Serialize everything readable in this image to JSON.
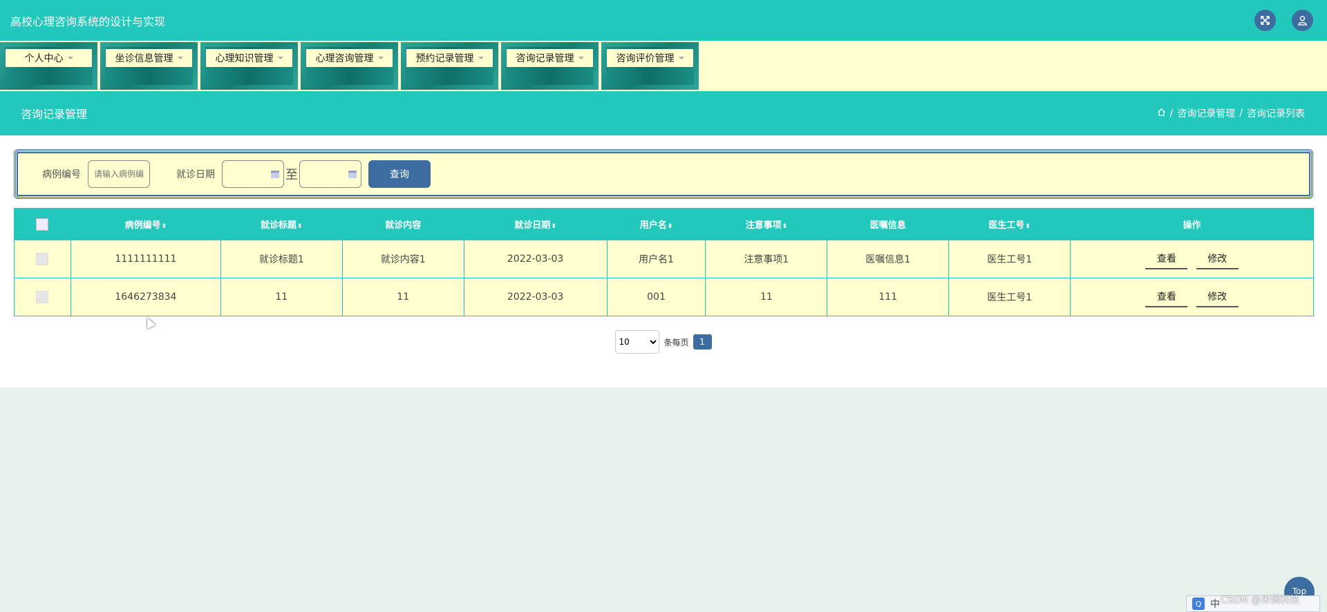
{
  "header": {
    "app_title": "高校心理咨询系统的设计与实现",
    "icons": [
      "fullscreen-icon",
      "user-icon"
    ]
  },
  "menu": {
    "items": [
      {
        "label": "个人中心"
      },
      {
        "label": "坐诊信息管理"
      },
      {
        "label": "心理知识管理"
      },
      {
        "label": "心理咨询管理"
      },
      {
        "label": "预约记录管理"
      },
      {
        "label": "咨询记录管理"
      },
      {
        "label": "咨询评价管理"
      }
    ]
  },
  "section": {
    "title": "咨询记录管理",
    "breadcrumb": [
      "咨询记录管理",
      "咨询记录列表"
    ]
  },
  "search": {
    "case_no_label": "病例编号",
    "case_no_placeholder": "请输入病例编号",
    "date_label": "就诊日期",
    "to_text": "至",
    "query_button": "查询"
  },
  "table": {
    "headers": [
      "病例编号",
      "就诊标题",
      "就诊内容",
      "就诊日期",
      "用户名",
      "注意事项",
      "医嘱信息",
      "医生工号",
      "操作"
    ],
    "sortable": [
      true,
      true,
      false,
      true,
      true,
      true,
      false,
      true,
      false
    ],
    "rows": [
      {
        "case_no": "1111111111",
        "title": "就诊标题1",
        "content": "就诊内容1",
        "date": "2022-03-03",
        "username": "用户名1",
        "notes": "注意事项1",
        "advice": "医嘱信息1",
        "doctor_no": "医生工号1"
      },
      {
        "case_no": "1646273834",
        "title": "11",
        "content": "11",
        "date": "2022-03-03",
        "username": "001",
        "notes": "11",
        "advice": "111",
        "doctor_no": "医生工号1"
      }
    ],
    "view_label": "查看",
    "edit_label": "修改"
  },
  "pagination": {
    "page_size": "10",
    "per_page_label": "条每页",
    "current_page": "1"
  },
  "overlay": {
    "top_label": "Top",
    "ime_text": "中",
    "watermark": "CSDN @米偶科技"
  },
  "colors": {
    "accent": "#22c8bb",
    "cream": "#ffffd0",
    "button_blue": "#3d6da0"
  }
}
